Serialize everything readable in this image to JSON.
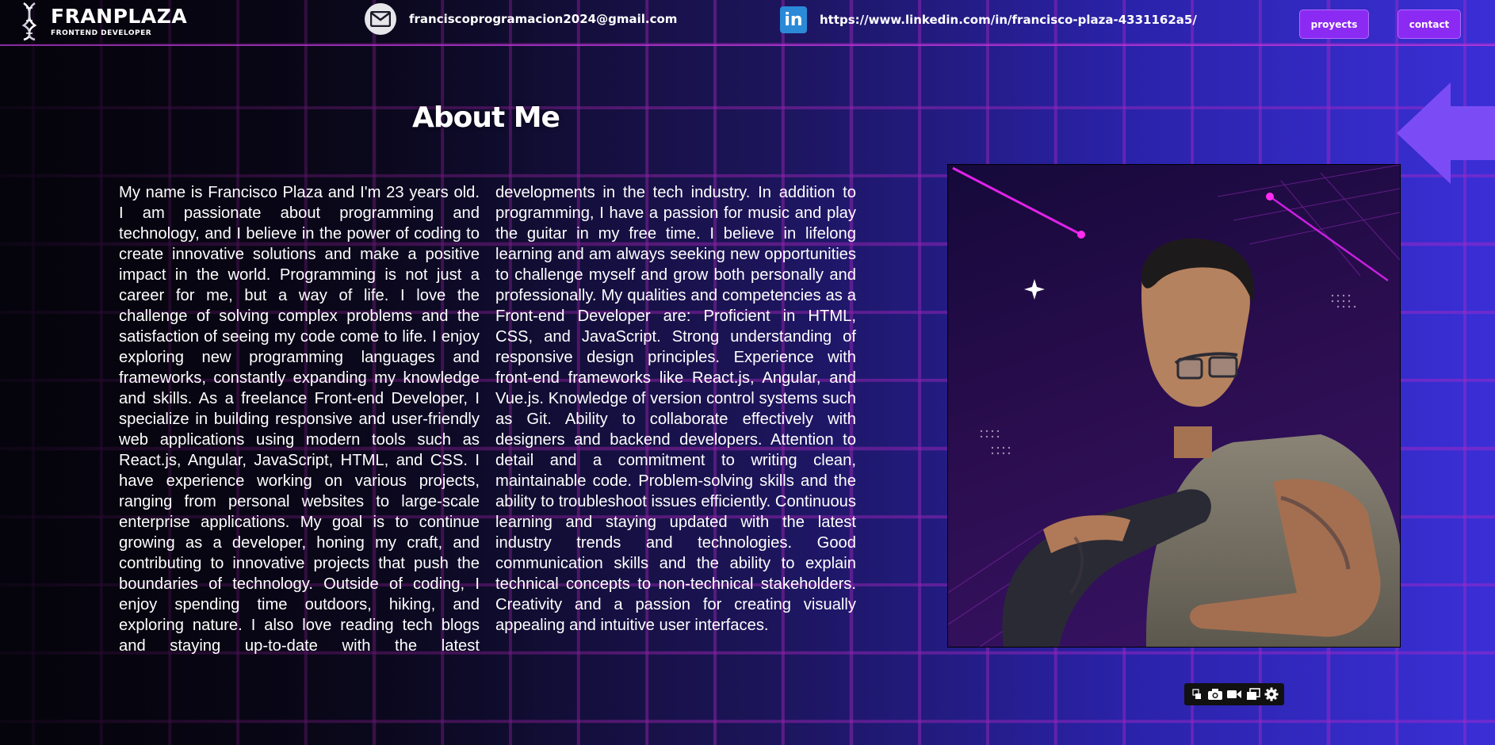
{
  "header": {
    "brand": "FRANPLAZA",
    "role": "FRONTEND DEVELOPER",
    "email": "franciscoprogramacion2024@gmail.com",
    "linkedin": "https://www.linkedin.com/in/francisco-plaza-4331162a5/",
    "linkedin_icon_text": "in",
    "nav": {
      "projects": "proyects",
      "contact": "contact"
    }
  },
  "main": {
    "title": "About Me",
    "bio": "My name is Francisco Plaza and I'm 23 years old. I am passionate about programming and technology, and I believe in the power of coding to create innovative solutions and make a positive impact in the world. Programming is not just a career for me, but a way of life. I love the challenge of solving complex problems and the satisfaction of seeing my code come to life. I enjoy exploring new programming languages and frameworks, constantly expanding my knowledge and skills. As a freelance Front-end Developer, I specialize in building responsive and user-friendly web applications using modern tools such as React.js, Angular, JavaScript, HTML, and CSS. I have experience working on various projects, ranging from personal websites to large-scale enterprise applications. My goal is to continue growing as a developer, honing my craft, and contributing to innovative projects that push the boundaries of technology. Outside of coding, I enjoy spending time outdoors, hiking, and exploring nature. I also love reading tech blogs and staying up-to-date with the latest developments in the tech industry. In addition to programming, I have a passion for music and play the guitar in my free time. I believe in lifelong learning and am always seeking new opportunities to challenge myself and grow both personally and professionally. My qualities and competencies as a Front-end Developer are: Proficient in HTML, CSS, and JavaScript. Strong understanding of responsive design principles. Experience with front-end frameworks like React.js, Angular, and Vue.js. Knowledge of version control systems such as Git. Ability to collaborate effectively with designers and backend developers. Attention to detail and a commitment to writing clean, maintainable code. Problem-solving skills and the ability to troubleshoot issues efficiently. Continuous learning and staying updated with the latest industry trends and technologies. Good communication skills and the ability to explain technical concepts to non-technical stakeholders. Creativity and a passion for creating visually appealing and intuitive user interfaces."
  },
  "colors": {
    "accent": "#8b2af2",
    "grid": "#be28c8",
    "arrow": "#7b4cf5"
  },
  "icons": {
    "logo": "dna-icon",
    "email": "mail-icon",
    "linkedin": "linkedin-icon",
    "toolbar": [
      "translate-icon",
      "camera-icon",
      "video-icon",
      "window-icon",
      "gear-icon"
    ]
  }
}
